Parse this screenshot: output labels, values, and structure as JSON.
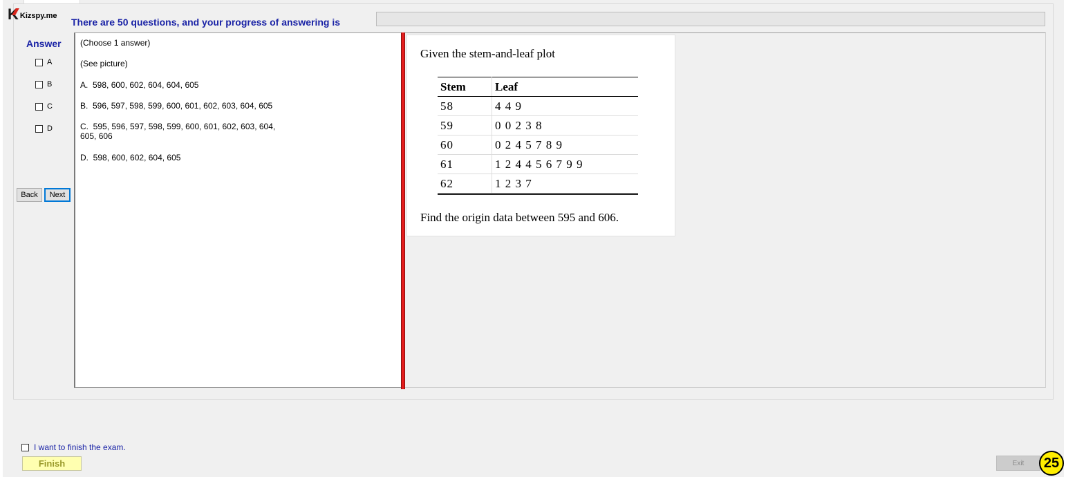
{
  "brand": {
    "logo_letter": "K",
    "logo_text": "Kizspy.me"
  },
  "header": {
    "progress_text": "There are 50 questions, and your progress of answering is",
    "progress_fraction": 0
  },
  "answer_panel": {
    "title": "Answer",
    "options": [
      {
        "label": "A",
        "checked": false
      },
      {
        "label": "B",
        "checked": false
      },
      {
        "label": "C",
        "checked": false
      },
      {
        "label": "D",
        "checked": false
      }
    ],
    "back_label": "Back",
    "next_label": "Next"
  },
  "question": {
    "instruction": "(Choose 1 answer)",
    "see_picture": "(See picture)",
    "choices": [
      "A.  598, 600, 602, 604, 604, 605",
      "B.  596, 597, 598, 599, 600, 601, 602, 603, 604, 605",
      "C.  595, 596, 597, 598, 599, 600, 601, 602, 603, 604,",
      "605, 606",
      "D.  598, 600, 602, 604, 605"
    ]
  },
  "picture": {
    "title": "Given the stem-and-leaf plot",
    "headers": [
      "Stem",
      "Leaf"
    ],
    "rows": [
      {
        "stem": "58",
        "leaf": "4 4 9"
      },
      {
        "stem": "59",
        "leaf": "0 0 2 3 8"
      },
      {
        "stem": "60",
        "leaf": "0 2 4 5 7 8 9"
      },
      {
        "stem": "61",
        "leaf": "1 2 4 4 5 6 7 9 9"
      },
      {
        "stem": "62",
        "leaf": "1 2 3 7"
      }
    ],
    "footer": "Find the origin data between 595 and 606."
  },
  "footer": {
    "finish_checkbox_label": "I want to finish the exam.",
    "finish_label": "Finish",
    "exit_label": "Exit",
    "question_number": "25"
  },
  "colors": {
    "accent_blue": "#1a23a6",
    "splitter_red": "#e41e1e",
    "finish_bg": "#ffffb0",
    "badge_yellow": "#ffee00"
  }
}
